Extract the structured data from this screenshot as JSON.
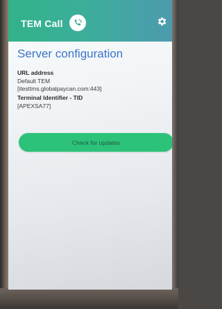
{
  "appbar": {
    "title": "TEM Call",
    "call_icon": "phone-sync-icon",
    "settings_icon": "gear-icon",
    "color_start": "#31b389",
    "color_end": "#4c9bae"
  },
  "server_config": {
    "title": "Server configuration",
    "url_label": "URL address",
    "url_name": "Default TEM",
    "url_value": "[itesttms.globalpaycan.com:443]",
    "tid_label": "Terminal Identifier - TID",
    "tid_value": "[APEXSA77]"
  },
  "actions": {
    "check_updates_label": "Check for updates",
    "button_color": "#2dc27a"
  }
}
